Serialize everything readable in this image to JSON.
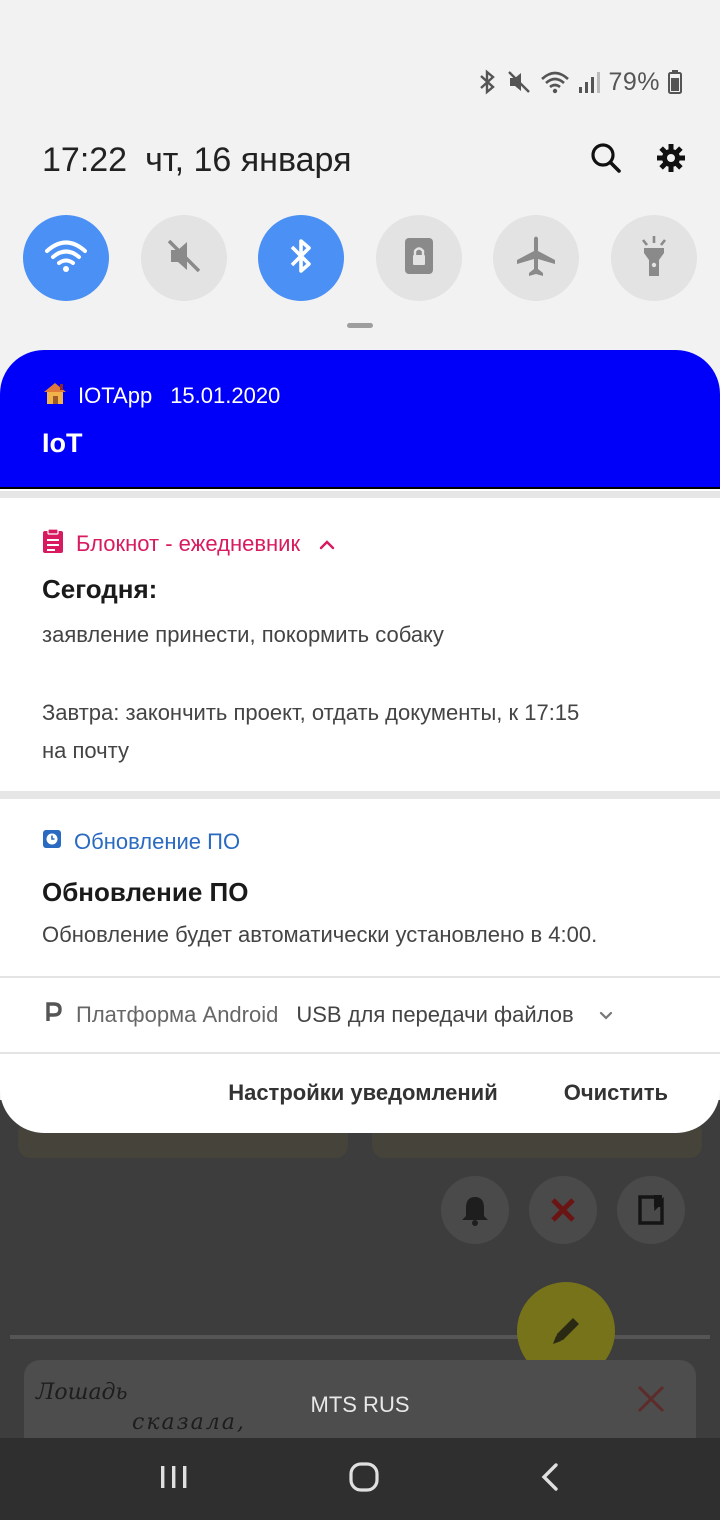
{
  "status_bar": {
    "battery_percent": "79%",
    "icons": [
      "bluetooth-icon",
      "mute-icon",
      "wifi-icon",
      "signal-icon",
      "battery-icon"
    ]
  },
  "header": {
    "time": "17:22",
    "date": "чт, 16 января"
  },
  "quick_toggles": [
    {
      "name": "wifi",
      "icon": "wifi-icon",
      "active": true
    },
    {
      "name": "sound",
      "icon": "mute-icon",
      "active": false
    },
    {
      "name": "bluetooth",
      "icon": "bluetooth-icon",
      "active": true
    },
    {
      "name": "rotation",
      "icon": "portrait-lock-icon",
      "active": false
    },
    {
      "name": "airplane",
      "icon": "airplane-icon",
      "active": false
    },
    {
      "name": "flashlight",
      "icon": "flashlight-icon",
      "active": false
    }
  ],
  "notifications": {
    "iot": {
      "app_name": "IOTApp",
      "date": "15.01.2020",
      "title": "IoT",
      "background": "#0000fa"
    },
    "notepad": {
      "app_name": "Блокнот - ежедневник",
      "title": "Сегодня:",
      "line1": "заявление принести, покормить собаку",
      "line2": "Завтра: закончить проект, отдать документы, к 17:15",
      "line3": "на почту",
      "accent": "#d81b60"
    },
    "update": {
      "app_name": "Обновление ПО",
      "title": "Обновление ПО",
      "body": "Обновление будет автоматически установлено в 4:00.",
      "accent": "#2a6ac0"
    },
    "android": {
      "app_name": "Платформа Android",
      "text": "USB для передачи файлов"
    }
  },
  "actions": {
    "settings": "Настройки уведомлений",
    "clear": "Очистить"
  },
  "background_app": {
    "note_line1": "Лошадь",
    "note_line2": "сказала,"
  },
  "carrier": "MTS RUS",
  "nav": {
    "icons": [
      "recent-apps-icon",
      "home-icon",
      "back-icon"
    ]
  }
}
